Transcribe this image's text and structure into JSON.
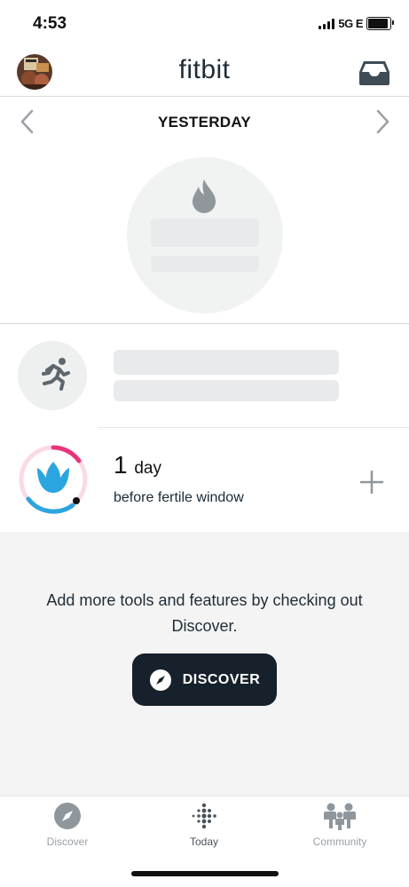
{
  "status_bar": {
    "time": "4:53",
    "network": "5G E"
  },
  "header": {
    "brand": "fitbit"
  },
  "date_nav": {
    "title": "YESTERDAY"
  },
  "fertility": {
    "count": "1",
    "unit": "day",
    "subtitle": "before fertile window"
  },
  "discover_prompt": {
    "text": "Add more tools and features by checking out Discover.",
    "button_label": "DISCOVER"
  },
  "tabs": [
    {
      "label": "Discover",
      "icon": "compass-icon"
    },
    {
      "label": "Today",
      "icon": "fitbit-dots-icon",
      "active": true
    },
    {
      "label": "Community",
      "icon": "community-icon"
    }
  ],
  "colors": {
    "accent_pink": "#e8347a",
    "accent_blue": "#2aa5e0",
    "dark": "#16212b"
  }
}
